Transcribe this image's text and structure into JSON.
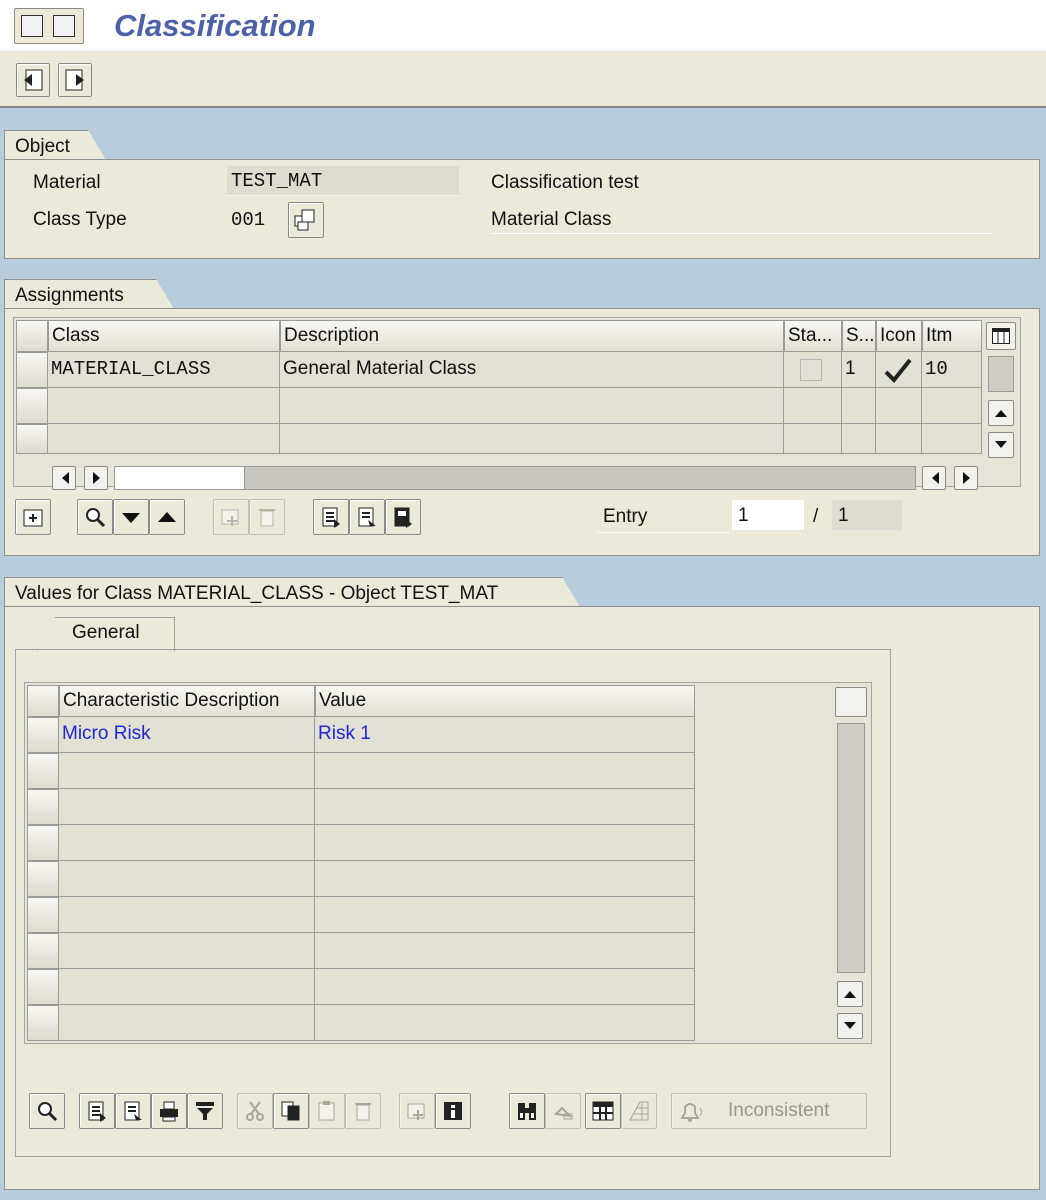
{
  "window": {
    "title": "Classification"
  },
  "object_group": {
    "header": "Object",
    "material_label": "Material",
    "material_value": "TEST_MAT",
    "material_desc": "Classification test",
    "class_type_label": "Class Type",
    "class_type_value": "001",
    "class_type_desc": "Material Class"
  },
  "assignments": {
    "header": "Assignments",
    "columns": [
      "Class",
      "Description",
      "Sta...",
      "S...",
      "Icon",
      "Itm"
    ],
    "rows": [
      {
        "class": "MATERIAL_CLASS",
        "description": "General Material Class",
        "status": "",
        "s": "1",
        "itm": "10"
      }
    ],
    "entry_label": "Entry",
    "entry_value": "1",
    "entry_sep": "/",
    "entry_total": "1"
  },
  "values": {
    "header": "Values for Class MATERIAL_CLASS - Object TEST_MAT",
    "tab_general": "General",
    "columns": [
      "Characteristic Description",
      "Value"
    ],
    "rows": [
      {
        "desc": "Micro Risk",
        "value": "Risk 1"
      }
    ],
    "inconsistent_label": "Inconsistent"
  },
  "colors": {
    "link": "#1b27d8",
    "title": "#4b61a8",
    "panel": "#ece9d8",
    "background": "#b7cddd"
  }
}
